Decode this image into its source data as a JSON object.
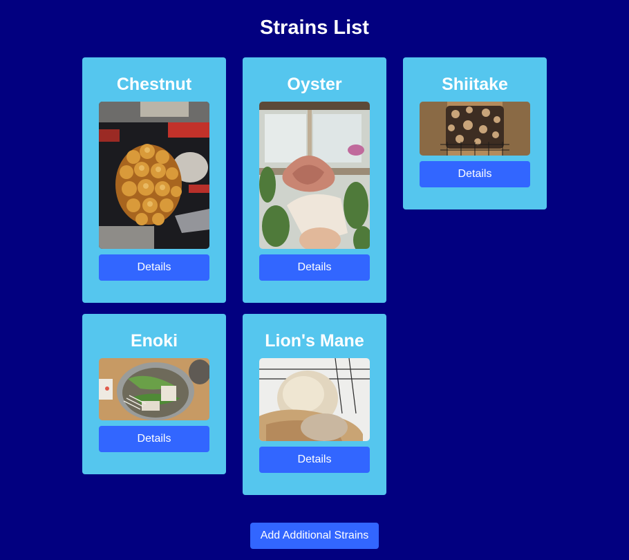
{
  "page": {
    "title": "Strains List"
  },
  "strains": [
    {
      "name": "Chestnut",
      "details_label": "Details",
      "image": "chestnut-mushroom-photo"
    },
    {
      "name": "Oyster",
      "details_label": "Details",
      "image": "pink-oyster-mushroom-photo"
    },
    {
      "name": "Shiitake",
      "details_label": "Details",
      "image": "shiitake-block-photo"
    },
    {
      "name": "Enoki",
      "details_label": "Details",
      "image": "enoki-dish-photo"
    },
    {
      "name": "Lion's Mane",
      "details_label": "Details",
      "image": "lions-mane-photo"
    }
  ],
  "actions": {
    "add_label": "Add Additional Strains"
  },
  "colors": {
    "background": "#020080",
    "card": "#55c6ee",
    "button": "#3266ff",
    "text": "#ffffff"
  }
}
